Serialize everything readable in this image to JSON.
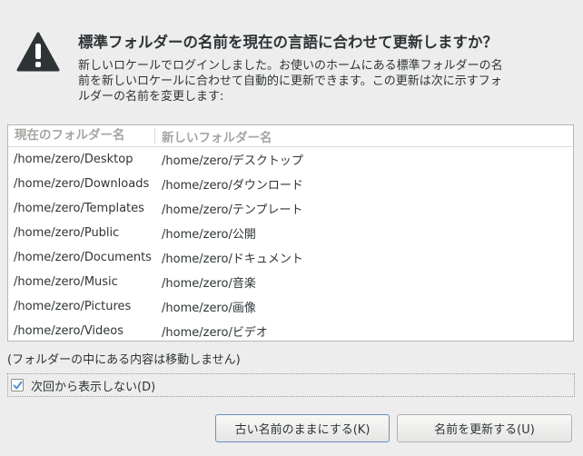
{
  "dialog": {
    "icon": "warning-icon",
    "heading": "標準フォルダーの名前を現在の言語に合わせて更新しますか？",
    "message_lines": [
      "新しいロケールでログインしました。お使いのホームにある標準フォルダーの名",
      "前を新しいロケールに合わせて自動的に更新できます。この更新は次に示すフォ",
      "ルダーの名前を変更します:"
    ]
  },
  "table": {
    "columns": [
      "現在のフォルダー名",
      "新しいフォルダー名"
    ],
    "rows": [
      {
        "current": "/home/zero/Desktop",
        "new": "/home/zero/デスクトップ"
      },
      {
        "current": "/home/zero/Downloads",
        "new": "/home/zero/ダウンロード"
      },
      {
        "current": "/home/zero/Templates",
        "new": "/home/zero/テンプレート"
      },
      {
        "current": "/home/zero/Public",
        "new": "/home/zero/公開"
      },
      {
        "current": "/home/zero/Documents",
        "new": "/home/zero/ドキュメント"
      },
      {
        "current": "/home/zero/Music",
        "new": "/home/zero/音楽"
      },
      {
        "current": "/home/zero/Pictures",
        "new": "/home/zero/画像"
      },
      {
        "current": "/home/zero/Videos",
        "new": "/home/zero/ビデオ"
      }
    ]
  },
  "note": "(フォルダーの中にある内容は移動しません)",
  "dont_show": {
    "label": "次回から表示しない(D)",
    "checked": true
  },
  "buttons": {
    "keep_label": "古い名前のままにする(K)",
    "update_label": "名前を更新する(U)"
  },
  "colors": {
    "background": "#ededed",
    "icon": "#2e3436",
    "check_accent": "#4a90d9"
  }
}
